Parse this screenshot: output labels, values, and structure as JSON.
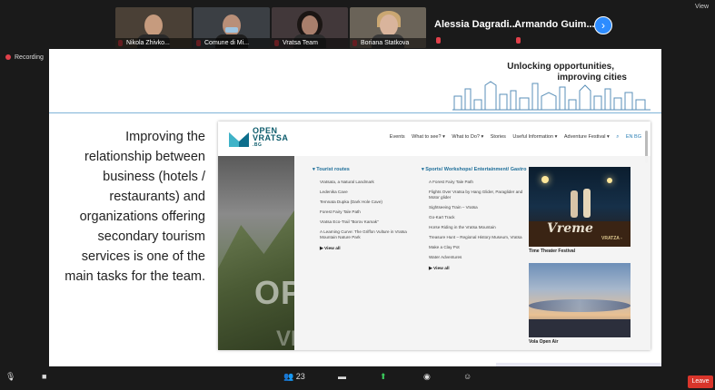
{
  "participants": [
    {
      "name": "Nikola Zhivko...",
      "bg": "#4a4036",
      "face": "#c69b7e"
    },
    {
      "name": "Comune di Mi...",
      "bg": "#3b3f44",
      "face": "#b98f78"
    },
    {
      "name": "Vratsa Team",
      "bg": "#42383a",
      "face": "#a97f6c"
    },
    {
      "name": "Boriana Statkova",
      "bg": "#6a6358",
      "face": "#d9b49c"
    }
  ],
  "name_tiles": [
    "Alessia Dagradi...",
    "Armando Guim..."
  ],
  "next_icon": "chevron-right-icon",
  "view_label": "View",
  "recording_label": "Recording",
  "slide": {
    "tagline_1": "Unlocking opportunities,",
    "tagline_2": "improving cities",
    "body": "Improving the relationship between business (hotels / restaurants) and organizations offering secondary tourism services is one of the main tasks for the team."
  },
  "website": {
    "logo_line1": "OPEN",
    "logo_line2": "VRATSA",
    "logo_line3": ".BG",
    "nav": [
      "Events",
      "What to see? ▾",
      "What to Do? ▾",
      "Stories",
      "Useful Information ▾",
      "Adventure Festival ▾",
      "⌕",
      "EN BG"
    ],
    "hero_text_1": "OPEN",
    "hero_text_2": "VRATSA",
    "col1_head": "▾ Tourist routes",
    "col1_items": [
      "Vratsata, a Natural Landmark",
      "Ledenika Cave",
      "Temnata Dupka (Dark Hole Cave)",
      "Forest Fairy Tale Path",
      "Vratsa Eco-Trail \"Borov Kamak\"",
      "A Learning Curve: The Griffon Vulture in Vratsa",
      "Mountain Nature Park"
    ],
    "col1_view_all": "▶ View all",
    "col2_head": "▾ Sports/ Workshops/ Entertainment/ Gastro",
    "col2_items": [
      "A Forest Fairy Tale Path",
      "Flights Over Vratsa by Hang Glider, Paraglider and",
      "Motor glider",
      "Sightseeing Train – Vratsa",
      "Go-Kart Track",
      "Horse Riding in the Vratsa Mountain",
      "Treasure Hunt – Regional History Museum, Vratsa",
      "Make a Clay Pot",
      "Water Adventures"
    ],
    "col2_view_all": "▶ View all",
    "thumb1_caption": "Time Theater Festival",
    "thumb1_overlay": "Vreme",
    "thumb1_overlay2": "VRATZA -",
    "thumb2_caption": "Vola Open Air"
  },
  "toolbar": {
    "participants_count": "23",
    "leave_label": "Leave"
  }
}
